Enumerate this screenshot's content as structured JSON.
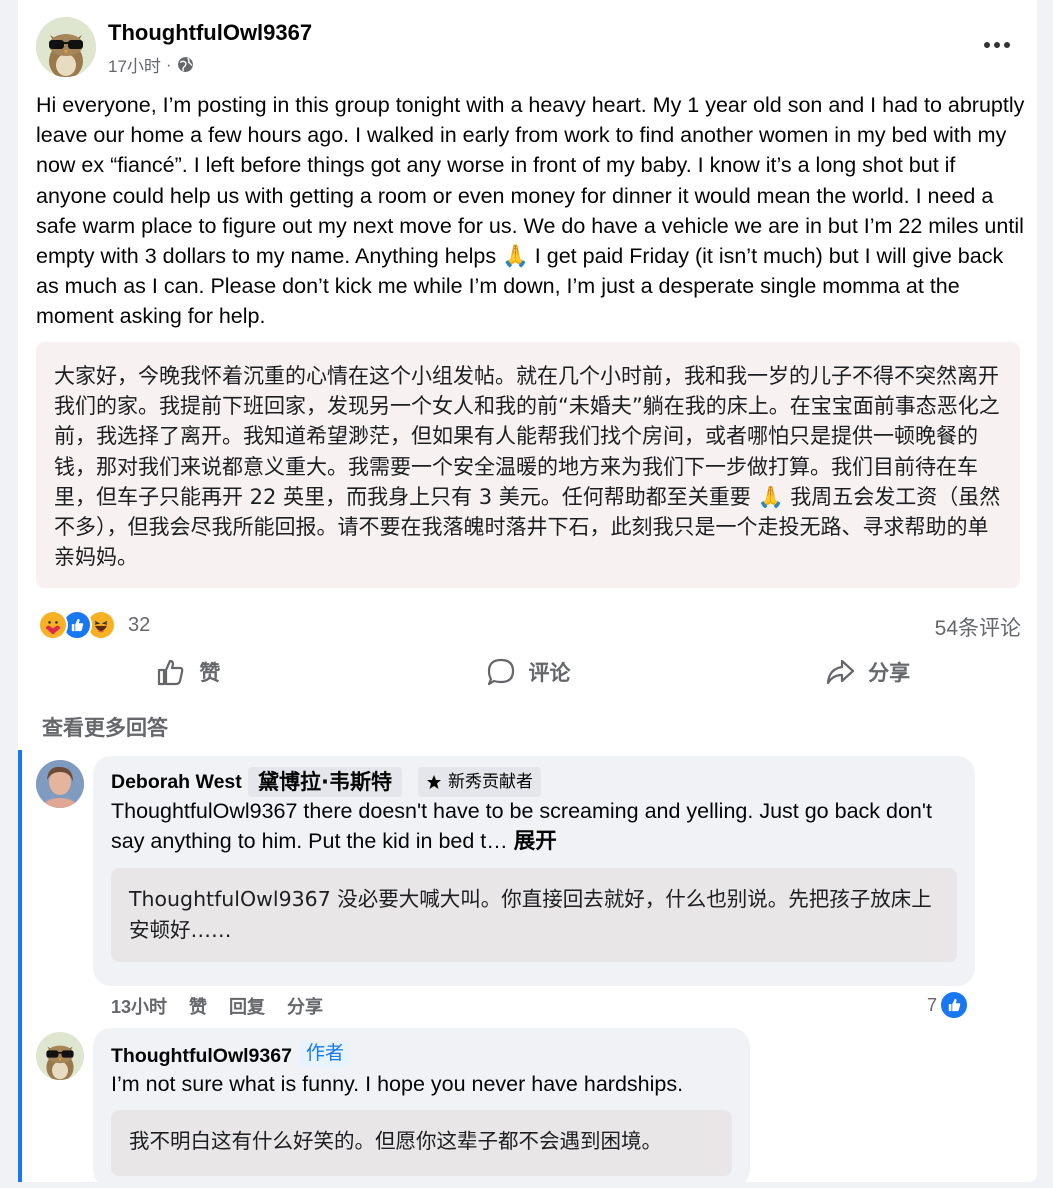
{
  "post": {
    "author": "ThoughtfulOwl9367",
    "time": "17小时",
    "separator": "·",
    "privacy_icon": "globe-icon",
    "more_icon": "more-options-icon",
    "body": "Hi everyone, I’m posting in this group tonight with a heavy heart. My 1 year old son and I had to abruptly leave our home a few hours ago. I walked in early from work to find another women in my bed with my now ex “fiancé”. I left before things got any worse in front of my baby. I know it’s a long shot but if anyone could help us with getting a room or even money for dinner it would mean the world. I need a safe warm place to figure out my next move for us. We do have a vehicle we are in but I’m 22 miles until empty with 3 dollars to my name. Anything helps 🙏 I get paid Friday (it isn’t much) but I will give back as much as I can. Please don’t kick me while I’m down, I’m just a desperate single momma at the moment asking for help.",
    "translation": "大家好，今晚我怀着沉重的心情在这个小组发帖。就在几个小时前，我和我一岁的儿子不得不突然离开我们的家。我提前下班回家，发现另一个女人和我的前“未婚夫”躺在我的床上。在宝宝面前事态恶化之前，我选择了离开。我知道希望渺茫，但如果有人能帮我们找个房间，或者哪怕只是提供一顿晚餐的钱，那对我们来说都意义重大。我需要一个安全温暖的地方来为我们下一步做打算。我们目前待在车里，但车子只能再开 22 英里，而我身上只有 3 美元。任何帮助都至关重要 🙏 我周五会发工资（虽然不多），但我会尽我所能回报。请不要在我落魄时落井下石，此刻我只是一个走投无路、寻求帮助的单亲妈妈。",
    "reaction_icons": [
      "care-reaction-icon",
      "like-reaction-icon",
      "haha-reaction-icon"
    ],
    "reaction_count": "32",
    "comment_count": "54条评论"
  },
  "actions": {
    "like": "赞",
    "comment": "评论",
    "share": "分享"
  },
  "more_replies": "查看更多回答",
  "comments": [
    {
      "name": "Deborah West",
      "name_translation": "黛博拉·韦斯特",
      "badge": "新秀贡献者",
      "text": "ThoughtfulOwl9367 there doesn't have to be screaming and yelling. Just go back don't say anything to him. Put the kid in bed t…",
      "see_more": "展开",
      "translation": "ThoughtfulOwl9367 没必要大喊大叫。你直接回去就好，什么也别说。先把孩子放床上安顿好……",
      "time": "13小时",
      "like": "赞",
      "reply": "回复",
      "share": "分享",
      "likes": "7"
    },
    {
      "name": "ThoughtfulOwl9367",
      "author_label": "作者",
      "text": "I’m not sure what is funny. I hope you never have hardships.",
      "translation": "我不明白这有什么好笑的。但愿你这辈子都不会遇到困境。"
    }
  ]
}
